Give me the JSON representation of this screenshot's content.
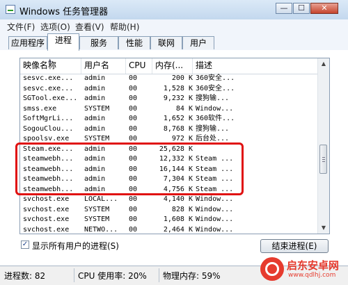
{
  "window": {
    "title": "Windows 任务管理器",
    "minimize": "—",
    "maximize": "☐",
    "close": "✕"
  },
  "menubar": [
    "文件(F)",
    "选项(O)",
    "查看(V)",
    "帮助(H)"
  ],
  "tabs": [
    {
      "label": "应用程序",
      "active": false
    },
    {
      "label": "进程",
      "active": true
    },
    {
      "label": "服务",
      "active": false
    },
    {
      "label": "性能",
      "active": false
    },
    {
      "label": "联网",
      "active": false
    },
    {
      "label": "用户",
      "active": false
    }
  ],
  "process_table": {
    "headers": [
      "映像名称",
      "用户名",
      "CPU",
      "内存(...",
      "描述"
    ],
    "sort_indicator": "▲",
    "rows": [
      [
        "sesvc.exe...",
        "admin",
        "00",
        "200 K",
        "360安全..."
      ],
      [
        "sesvc.exe...",
        "admin",
        "00",
        "1,528 K",
        "360安全..."
      ],
      [
        "SGTool.exe...",
        "admin",
        "00",
        "9,232 K",
        "搜狗输..."
      ],
      [
        "smss.exe",
        "SYSTEM",
        "00",
        "84 K",
        "Window..."
      ],
      [
        "SoftMgrLi...",
        "admin",
        "00",
        "1,652 K",
        "360软件..."
      ],
      [
        "SogouClou...",
        "admin",
        "00",
        "8,768 K",
        "搜狗输..."
      ],
      [
        "spoolsv.exe",
        "SYSTEM",
        "00",
        "972 K",
        "后台处..."
      ],
      [
        "Steam.exe...",
        "admin",
        "00",
        "25,628 K",
        ""
      ],
      [
        "steamwebh...",
        "admin",
        "00",
        "12,332 K",
        "Steam ..."
      ],
      [
        "steamwebh...",
        "admin",
        "00",
        "16,144 K",
        "Steam ..."
      ],
      [
        "steamwebh...",
        "admin",
        "00",
        "7,304 K",
        "Steam ..."
      ],
      [
        "steamwebh...",
        "admin",
        "00",
        "4,756 K",
        "Steam ..."
      ],
      [
        "svchost.exe",
        "LOCAL...",
        "00",
        "4,140 K",
        "Window..."
      ],
      [
        "svchost.exe",
        "SYSTEM",
        "00",
        "828 K",
        "Window..."
      ],
      [
        "svchost.exe",
        "SYSTEM",
        "00",
        "1,608 K",
        "Window..."
      ],
      [
        "svchost.exe",
        "NETWO...",
        "00",
        "2,464 K",
        "Window..."
      ]
    ]
  },
  "show_all_processes": {
    "checked": true,
    "check_mark": "✓",
    "label": "显示所有用户的进程(S)"
  },
  "end_process_button": "结束进程(E)",
  "statusbar": {
    "processes": "进程数: 82",
    "cpu": "CPU 使用率: 20%",
    "memory": "物理内存: 59%"
  },
  "watermark": {
    "text": "启东安卓网",
    "url": "www.qdlhj.com"
  },
  "colors": {
    "highlight": "#e01010",
    "watermark": "#e63b2e"
  }
}
